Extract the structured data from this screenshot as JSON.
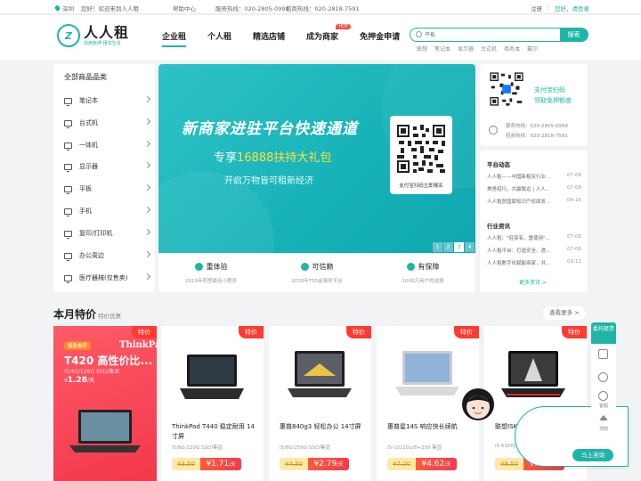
{
  "topbar": {
    "city": "深圳",
    "welcome": "您好！欢迎来到人人租",
    "help": "帮助中心",
    "hotline1": "服务热线：020-2805-0999",
    "hotline2": "招商热线：020-2818-7591",
    "register": "注册",
    "separator": "|",
    "login": "您好，请登录"
  },
  "logo": {
    "mark": "Z",
    "name": "人人租",
    "slogan": "信用免押 租享生活"
  },
  "nav": {
    "items": [
      "企业租",
      "个人租",
      "精选店铺",
      "成为商家",
      "免押金申请"
    ],
    "hot_badge": "HOT"
  },
  "search": {
    "placeholder": "平板",
    "button": "搜索",
    "hotwords": [
      "联想",
      "笔记本",
      "显示器",
      "台式机",
      "商务本",
      "戴尔"
    ]
  },
  "categories": {
    "title": "全部商品品类",
    "items": [
      "笔记本",
      "台式机",
      "一体机",
      "显示器",
      "平板",
      "手机",
      "复印/打印机",
      "办公周边",
      "医疗器械(仅售卖)"
    ]
  },
  "banner": {
    "headline": "新商家进驻平台快速通道",
    "sub_prefix": "专享",
    "sub_highlight": "16888扶持大礼包",
    "tagline": "开启万物皆可租新经济",
    "qr_caption": "支付宝扫码立即报名",
    "pages": [
      "1",
      "2",
      "3",
      "4"
    ],
    "active_page": "3"
  },
  "features": [
    {
      "title": "重体验",
      "sub": "2019年阿里最佳小程序"
    },
    {
      "title": "可信赖",
      "sub": "2018年TSS金猿奖平台"
    },
    {
      "title": "有保障",
      "sub": "1000万用户的选择"
    }
  ],
  "qrpanel": {
    "line1": "支付宝扫码",
    "line2": "领取免押额度",
    "phone1": "服务热线：020-2805-0999",
    "phone2": "招商热线：020-2818-7591"
  },
  "news": {
    "section1": "平台动态",
    "items1": [
      {
        "text": "人人租——中国新租赁行业...",
        "date": "07-08"
      },
      {
        "text": "美男招行，共赢致远 | 人人...",
        "date": "07-08"
      },
      {
        "text": "人人租获国家知识产权局发...",
        "date": "04-16"
      }
    ],
    "section2": "行业资讯",
    "items2": [
      {
        "text": "人人租：\"轻资有，重使用\"...",
        "date": "07-06"
      },
      {
        "text": "人人租平台：打造安全、透...",
        "date": "07-06"
      },
      {
        "text": "人人租数字化赋能商家，共...",
        "date": "03-11"
      }
    ],
    "more": "更多资讯 >"
  },
  "monthly": {
    "title": "本月特价",
    "subtitle": "特价优惠",
    "see_more": "查看更多 >",
    "badge": "特价"
  },
  "promo": {
    "tag": "爆款推荐",
    "brand": "ThinkPad",
    "title": "T420 高性价比...",
    "spec": "i5/4G/128G SSD/集显",
    "price_prefix": "¥",
    "price": "1.28",
    "unit": "/天"
  },
  "products": [
    {
      "name": "ThinkPad T440 稳定耐用 14寸屏",
      "spec": "i5/8G/120G SSD/集显",
      "old": "¥3.50",
      "price": "¥1.71",
      "unit": "/天"
    },
    {
      "name": "惠普840g3 轻松办公 14寸屏",
      "spec": "i5/8G/256G SSD/集显",
      "old": "¥4.50",
      "price": "¥2.79",
      "unit": "/天"
    },
    {
      "name": "惠普星14S 响应快长续航",
      "spec": "i5-10210u/8+256 集显",
      "old": "¥7.20",
      "price": "¥4.62",
      "unit": "/天"
    },
    {
      "name": "联想ISK 小型游戏首选",
      "spec": "i5-6300/16G/128G+1T/GTX960",
      "old": "¥8.50",
      "price": "¥5.22",
      "unit": "/天"
    }
  ],
  "floatbar": {
    "top": "委托租赁",
    "items": [
      "客服",
      "顶部"
    ]
  },
  "cs": {
    "button": "马上咨询"
  },
  "colors": {
    "accent": "#1fb5a6",
    "promo": "#f2384a",
    "price": "#f53a4e"
  }
}
